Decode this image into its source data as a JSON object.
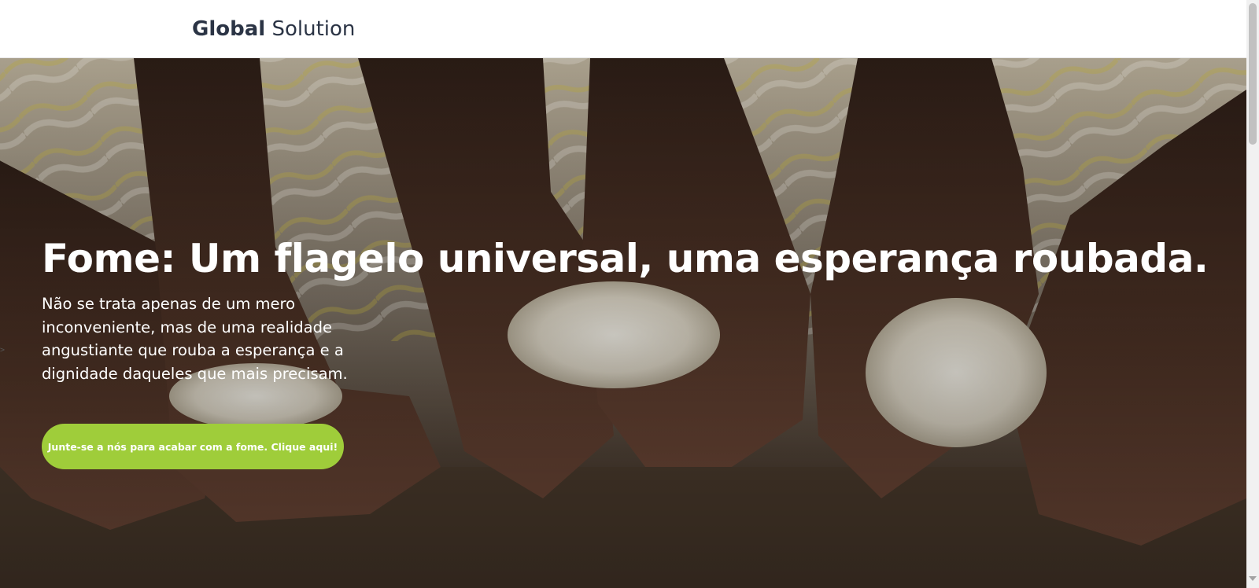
{
  "header": {
    "brand_bold": "Global",
    "brand_light": " Solution"
  },
  "hero": {
    "title": "Fome: Um flagelo universal, uma esperança roubada.",
    "text": "Não se trata apenas de um mero inconveniente, mas de uma realidade angustiante que rouba a esperança e a dignidade daqueles que mais precisam.",
    "cta_label": "Junte-se a nós para acabar com a fome. Clique aqui!",
    "photo_icon": "hands-holding-rice-photo"
  },
  "edge_marker": ">",
  "colors": {
    "brand_text": "#2b3445",
    "cta_background": "#9fcd3a",
    "hero_text": "#ffffff"
  }
}
